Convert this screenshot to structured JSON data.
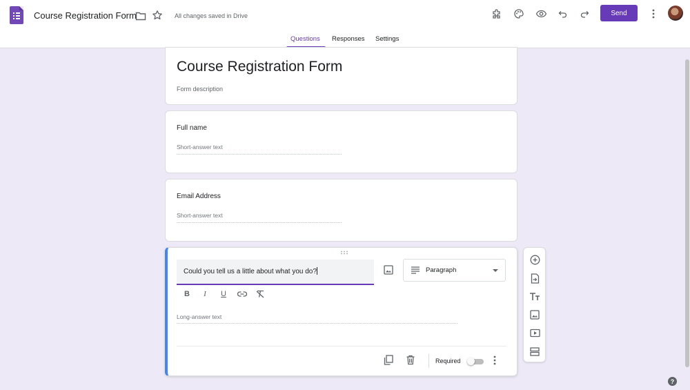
{
  "header": {
    "title": "Course Registration Form",
    "saved_status": "All changes saved in Drive",
    "send_label": "Send",
    "icons": [
      "forms-logo-icon",
      "folder-icon",
      "star-icon",
      "addon-puzzle-icon",
      "palette-icon",
      "preview-eye-icon",
      "undo-icon",
      "redo-icon",
      "more-vert-icon"
    ]
  },
  "tabs": [
    {
      "label": "Questions",
      "active": true
    },
    {
      "label": "Responses",
      "active": false
    },
    {
      "label": "Settings",
      "active": false
    }
  ],
  "form": {
    "title": "Course Registration Form",
    "description_placeholder": "Form description"
  },
  "questions": [
    {
      "label": "Full name",
      "answer_placeholder": "Short-answer text"
    },
    {
      "label": "Email Address",
      "answer_placeholder": "Short-answer text"
    }
  ],
  "active_question": {
    "text": "Could you tell us a little about what you do?",
    "type": "Paragraph",
    "answer_placeholder": "Long-answer text",
    "required_label": "Required",
    "required": false,
    "format_tools": {
      "bold": "B",
      "italic": "I",
      "underline": "U"
    }
  },
  "side_toolbar": [
    "add-question-icon",
    "import-questions-icon",
    "add-title-icon",
    "add-image-icon",
    "add-video-icon",
    "add-section-icon"
  ],
  "help_label": "?",
  "colors": {
    "accent": "#673ab7",
    "active_border": "#4285f4",
    "background": "#ede9f6"
  }
}
